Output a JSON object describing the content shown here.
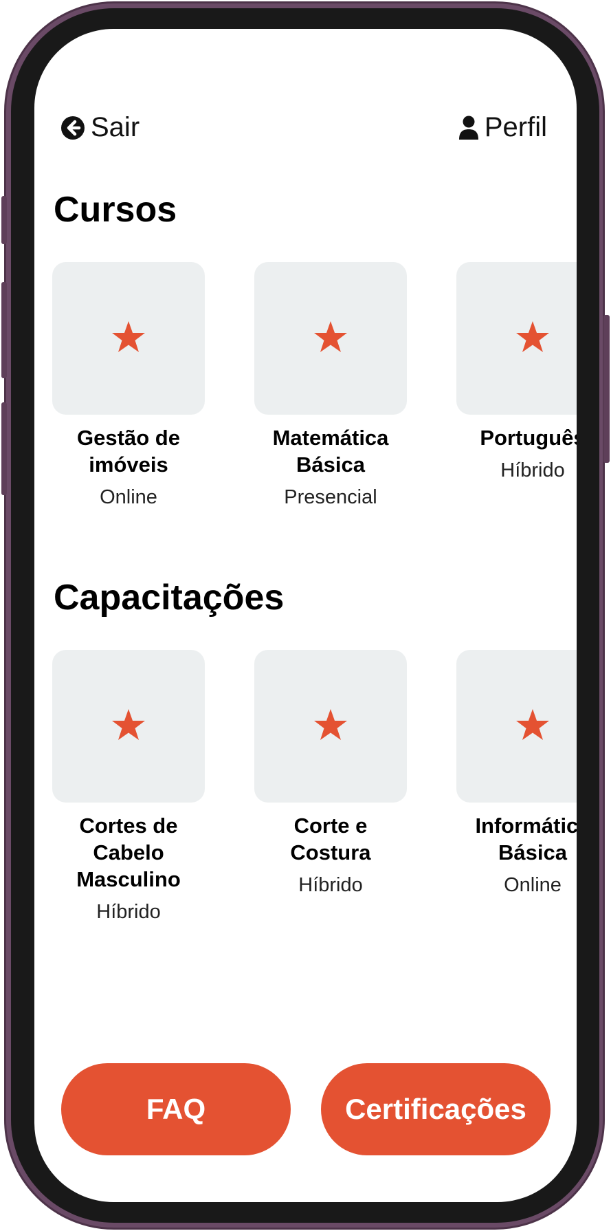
{
  "header": {
    "back_label": "Sair",
    "profile_label": "Perfil"
  },
  "sections": {
    "courses": {
      "title": "Cursos",
      "items": [
        {
          "title": "Gestão de\nimóveis",
          "mode": "Online"
        },
        {
          "title": "Matemática\nBásica",
          "mode": "Presencial"
        },
        {
          "title": "Português",
          "mode": "Híbrido"
        }
      ]
    },
    "trainings": {
      "title": "Capacitações",
      "items": [
        {
          "title": "Cortes de\nCabelo\nMasculino",
          "mode": "Híbrido"
        },
        {
          "title": "Corte e\nCostura",
          "mode": "Híbrido"
        },
        {
          "title": "Informática\nBásica",
          "mode": "Online"
        }
      ]
    }
  },
  "footer": {
    "faq_label": "FAQ",
    "cert_label": "Certificações"
  },
  "icons": {
    "back": "arrow-left-circle-icon",
    "profile": "user-icon",
    "card": "star-icon"
  },
  "colors": {
    "accent": "#e45232",
    "card_bg": "#eceff0",
    "frame": "#6a4a66"
  }
}
